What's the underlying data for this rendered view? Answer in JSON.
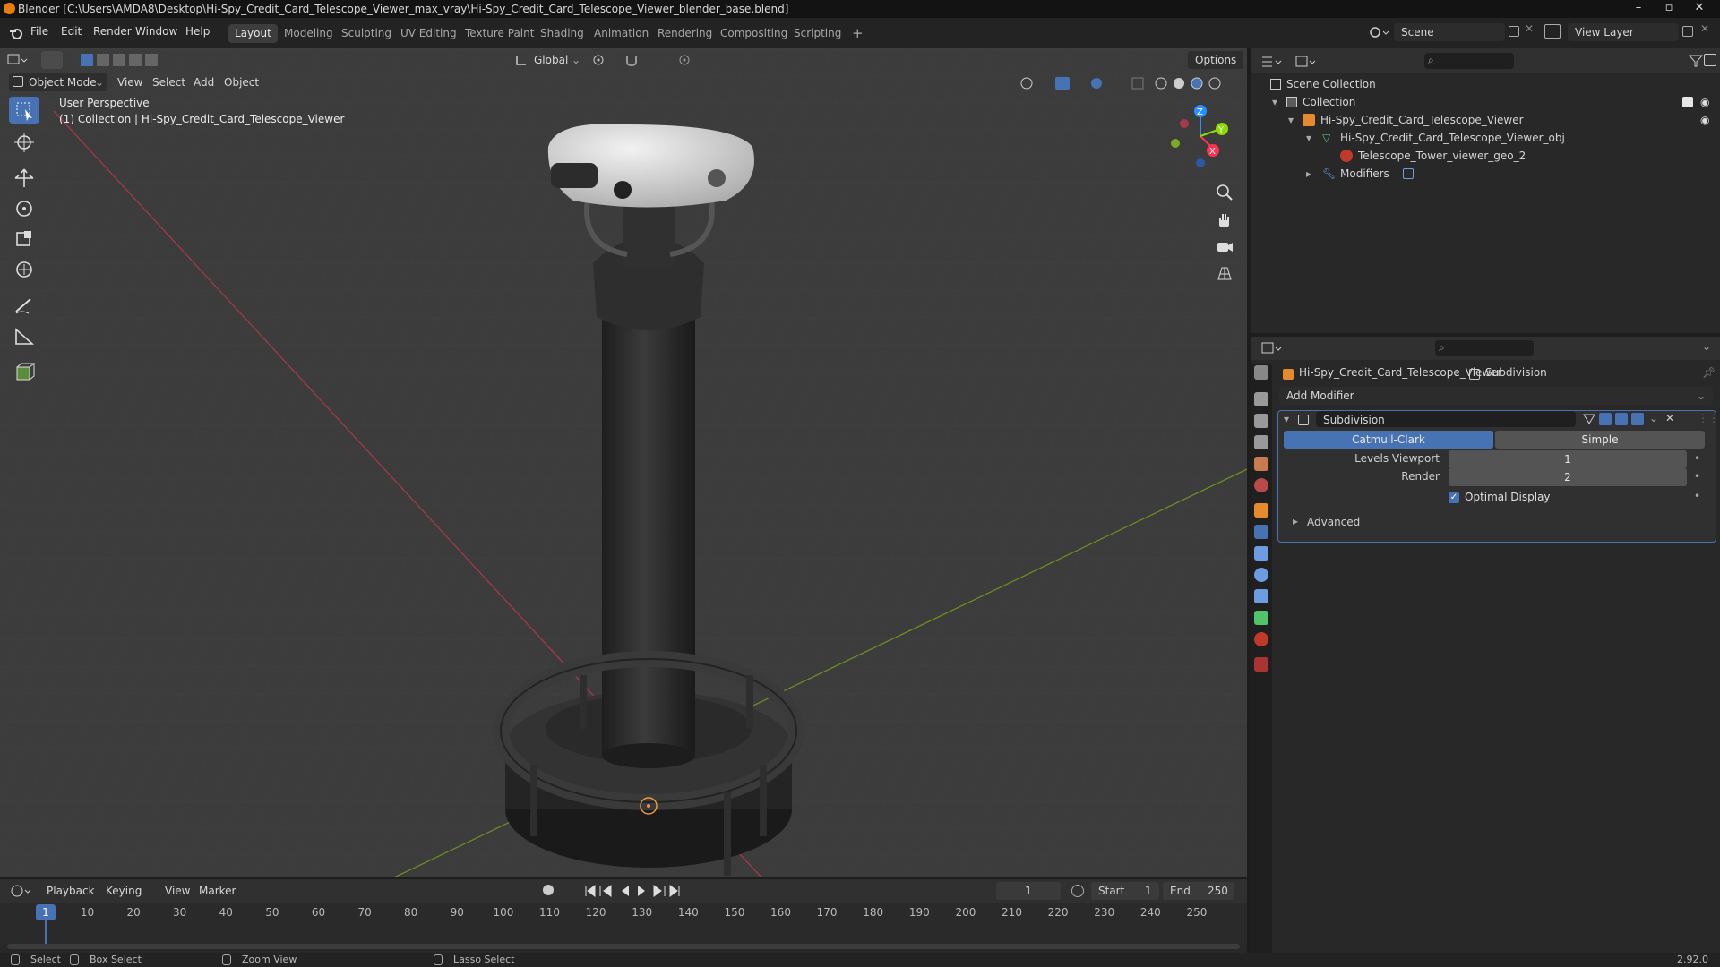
{
  "window": {
    "title": "Blender [C:\\Users\\AMDA8\\Desktop\\Hi-Spy_Credit_Card_Telescope_Viewer_max_vray\\Hi-Spy_Credit_Card_Telescope_Viewer_blender_base.blend]",
    "min": "–",
    "max": "▫",
    "close": "✕"
  },
  "menubar": {
    "items": [
      "File",
      "Edit",
      "Render",
      "Window",
      "Help"
    ],
    "workspaces": [
      "Layout",
      "Modeling",
      "Sculpting",
      "UV Editing",
      "Texture Paint",
      "Shading",
      "Animation",
      "Rendering",
      "Compositing",
      "Scripting"
    ],
    "active_workspace": "Layout",
    "add_tab": "+",
    "scene": "Scene",
    "view_layer": "View Layer"
  },
  "viewport": {
    "mode": "Object Mode",
    "menus": [
      "View",
      "Select",
      "Add",
      "Object"
    ],
    "orientation": "Global",
    "options": "Options",
    "overlay_title": "User Perspective",
    "overlay_sub": "(1) Collection | Hi-Spy_Credit_Card_Telescope_Viewer",
    "axes": {
      "x": "X",
      "y": "Y",
      "z": "Z"
    }
  },
  "outliner": {
    "root": "Scene Collection",
    "collection": "Collection",
    "object": "Hi-Spy_Credit_Card_Telescope_Viewer",
    "mesh": "Hi-Spy_Credit_Card_Telescope_Viewer_obj",
    "material": "Telescope_Tower_viewer_geo_2",
    "modifiers": "Modifiers"
  },
  "properties": {
    "breadcrumb_object": "Hi-Spy_Credit_Card_Telescope_Viewer",
    "breadcrumb_modifier": "Subdivision",
    "add_modifier": "Add Modifier",
    "modifier_name": "Subdivision",
    "catmull": "Catmull-Clark",
    "simple": "Simple",
    "levels_label": "Levels Viewport",
    "levels_value": "1",
    "render_label": "Render",
    "render_value": "2",
    "optimal": "Optimal Display",
    "advanced": "Advanced"
  },
  "timeline": {
    "menus": [
      "Playback",
      "Keying",
      "View",
      "Marker"
    ],
    "current": "1",
    "start_label": "Start",
    "start": "1",
    "end_label": "End",
    "end": "250",
    "ticks": [
      "1",
      "10",
      "20",
      "30",
      "40",
      "50",
      "60",
      "70",
      "80",
      "90",
      "100",
      "110",
      "120",
      "130",
      "140",
      "150",
      "160",
      "170",
      "180",
      "190",
      "200",
      "210",
      "220",
      "230",
      "240",
      "250"
    ]
  },
  "status": {
    "select": "Select",
    "box": "Box Select",
    "zoom": "Zoom View",
    "lasso": "Lasso Select",
    "version": "2.92.0"
  },
  "colors": {
    "accent": "#4772b3",
    "x_axis": "#ff3352",
    "y_axis": "#8bdc00",
    "z_axis": "#2890ff"
  }
}
